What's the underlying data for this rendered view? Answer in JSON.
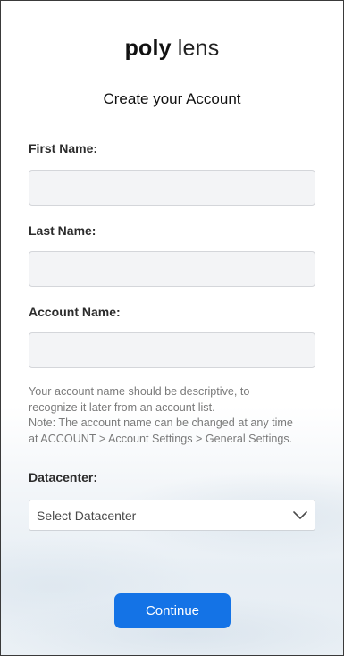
{
  "brand": {
    "logo_bold": "poly",
    "logo_light": "lens"
  },
  "title": "Create your Account",
  "form": {
    "first_name_label": "First Name:",
    "first_name_value": "",
    "last_name_label": "Last Name:",
    "last_name_value": "",
    "account_name_label": "Account Name:",
    "account_name_value": "",
    "help_line1": "Your account name should be descriptive, to",
    "help_line2": "recognize it later from an account list.",
    "help_line3": "Note: The account name can be changed at any time",
    "help_line4": "at ACCOUNT > Account Settings > General Settings.",
    "datacenter_label": "Datacenter:",
    "datacenter_selected": "Select Datacenter"
  },
  "actions": {
    "continue_label": "Continue"
  },
  "colors": {
    "primary_button": "#1473e6",
    "input_bg": "#f3f4f6"
  },
  "icons": {
    "dropdown": "chevron-down-icon"
  }
}
